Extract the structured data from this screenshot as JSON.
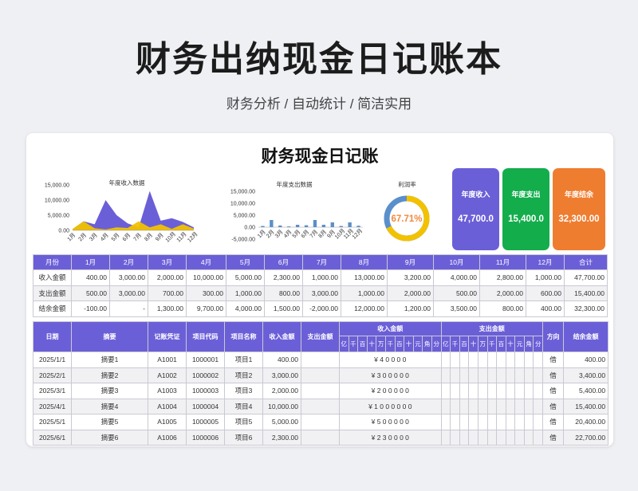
{
  "header": {
    "title": "财务出纳现金日记账本",
    "subtitle": "财务分析 / 自动统计 / 简洁实用"
  },
  "sheet": {
    "title": "财务现金日记账"
  },
  "colors": {
    "purple": "#6b5fd8",
    "green": "#13ad4c",
    "orange": "#ef7d30",
    "gold": "#f2c200",
    "bar": "#5b8fcb",
    "bar_neg": "#f08a3e"
  },
  "kpis": {
    "income": {
      "label": "年度收入",
      "value": "47,700.0"
    },
    "expense": {
      "label": "年度支出",
      "value": "15,400.0"
    },
    "balance": {
      "label": "年度结余",
      "value": "32,300.00"
    }
  },
  "chart_data": [
    {
      "type": "area",
      "title": "年度收入数据",
      "categories": [
        "1月",
        "2月",
        "3月",
        "4月",
        "5月",
        "6月",
        "7月",
        "8月",
        "9月",
        "10月",
        "11月",
        "12月"
      ],
      "y_ticks": [
        "15,000.00",
        "10,000.00",
        "5,000.00",
        "0.00"
      ],
      "ylim": [
        0,
        15000
      ],
      "series": [
        {
          "values": [
            400,
            3000,
            2000,
            10000,
            5000,
            2300,
            1000,
            13000,
            3200,
            4000,
            2800,
            1000
          ]
        },
        {
          "values": [
            500,
            3000,
            700,
            300,
            1000,
            800,
            3000,
            1000,
            2000,
            500,
            2000,
            600
          ]
        }
      ]
    },
    {
      "type": "bar",
      "title": "年度支出数据",
      "categories": [
        "1月",
        "2月",
        "3月",
        "4月",
        "5月",
        "6月",
        "7月",
        "8月",
        "9月",
        "10月",
        "11月",
        "12月"
      ],
      "y_ticks": [
        "15,000.00",
        "10,000.00",
        "5,000.00",
        "0.00",
        "-5,000.00"
      ],
      "ylim": [
        -5000,
        15000
      ],
      "values": [
        500,
        3000,
        700,
        300,
        1000,
        800,
        3000,
        1000,
        2000,
        500,
        2000,
        600
      ]
    },
    {
      "type": "pie",
      "title": "利润率",
      "label": "67.71%",
      "value": 0.6771
    }
  ],
  "monthly": {
    "headers": [
      "月份",
      "1月",
      "2月",
      "3月",
      "4月",
      "5月",
      "6月",
      "7月",
      "8月",
      "9月",
      "10月",
      "11月",
      "12月",
      "合计"
    ],
    "rows": [
      [
        "收入金额",
        "400.00",
        "3,000.00",
        "2,000.00",
        "10,000.00",
        "5,000.00",
        "2,300.00",
        "1,000.00",
        "13,000.00",
        "3,200.00",
        "4,000.00",
        "2,800.00",
        "1,000.00",
        "47,700.00"
      ],
      [
        "支出金额",
        "500.00",
        "3,000.00",
        "700.00",
        "300.00",
        "1,000.00",
        "800.00",
        "3,000.00",
        "1,000.00",
        "2,000.00",
        "500.00",
        "2,000.00",
        "600.00",
        "15,400.00"
      ],
      [
        "结余金额",
        "-100.00",
        "-",
        "1,300.00",
        "9,700.00",
        "4,000.00",
        "1,500.00",
        "-2,000.00",
        "12,000.00",
        "1,200.00",
        "3,500.00",
        "800.00",
        "400.00",
        "32,300.00"
      ]
    ]
  },
  "journal": {
    "headers": {
      "date": "日期",
      "summary": "摘要",
      "voucher": "记账凭证",
      "code": "项目代码",
      "name": "项目名称",
      "income": "收入金额",
      "expense": "支出金额",
      "income_amt": "收入金额",
      "expense_amt": "支出金额",
      "direction": "方向",
      "balance": "结余金额"
    },
    "digits": [
      "亿",
      "千",
      "百",
      "十",
      "万",
      "千",
      "百",
      "十",
      "元",
      "角",
      "分"
    ],
    "rows": [
      {
        "date": "2025/1/1",
        "summary": "摘要1",
        "voucher": "A1001",
        "code": "1000001",
        "name": "项目1",
        "income": "400.00",
        "expense": "",
        "income_digits": "¥ 4 0 0 0 0",
        "dir": "借",
        "balance": "400.00"
      },
      {
        "date": "2025/2/1",
        "summary": "摘要2",
        "voucher": "A1002",
        "code": "1000002",
        "name": "项目2",
        "income": "3,000.00",
        "expense": "",
        "income_digits": "¥ 3 0 0 0 0 0",
        "dir": "借",
        "balance": "3,400.00"
      },
      {
        "date": "2025/3/1",
        "summary": "摘要3",
        "voucher": "A1003",
        "code": "1000003",
        "name": "项目3",
        "income": "2,000.00",
        "expense": "",
        "income_digits": "¥ 2 0 0 0 0 0",
        "dir": "借",
        "balance": "5,400.00"
      },
      {
        "date": "2025/4/1",
        "summary": "摘要4",
        "voucher": "A1004",
        "code": "1000004",
        "name": "项目4",
        "income": "10,000.00",
        "expense": "",
        "income_digits": "¥ 1 0 0 0 0 0 0",
        "dir": "借",
        "balance": "15,400.00"
      },
      {
        "date": "2025/5/1",
        "summary": "摘要5",
        "voucher": "A1005",
        "code": "1000005",
        "name": "项目5",
        "income": "5,000.00",
        "expense": "",
        "income_digits": "¥ 5 0 0 0 0 0",
        "dir": "借",
        "balance": "20,400.00"
      },
      {
        "date": "2025/6/1",
        "summary": "摘要6",
        "voucher": "A1006",
        "code": "1000006",
        "name": "项目6",
        "income": "2,300.00",
        "expense": "",
        "income_digits": "¥ 2 3 0 0 0 0",
        "dir": "借",
        "balance": "22,700.00"
      }
    ]
  }
}
